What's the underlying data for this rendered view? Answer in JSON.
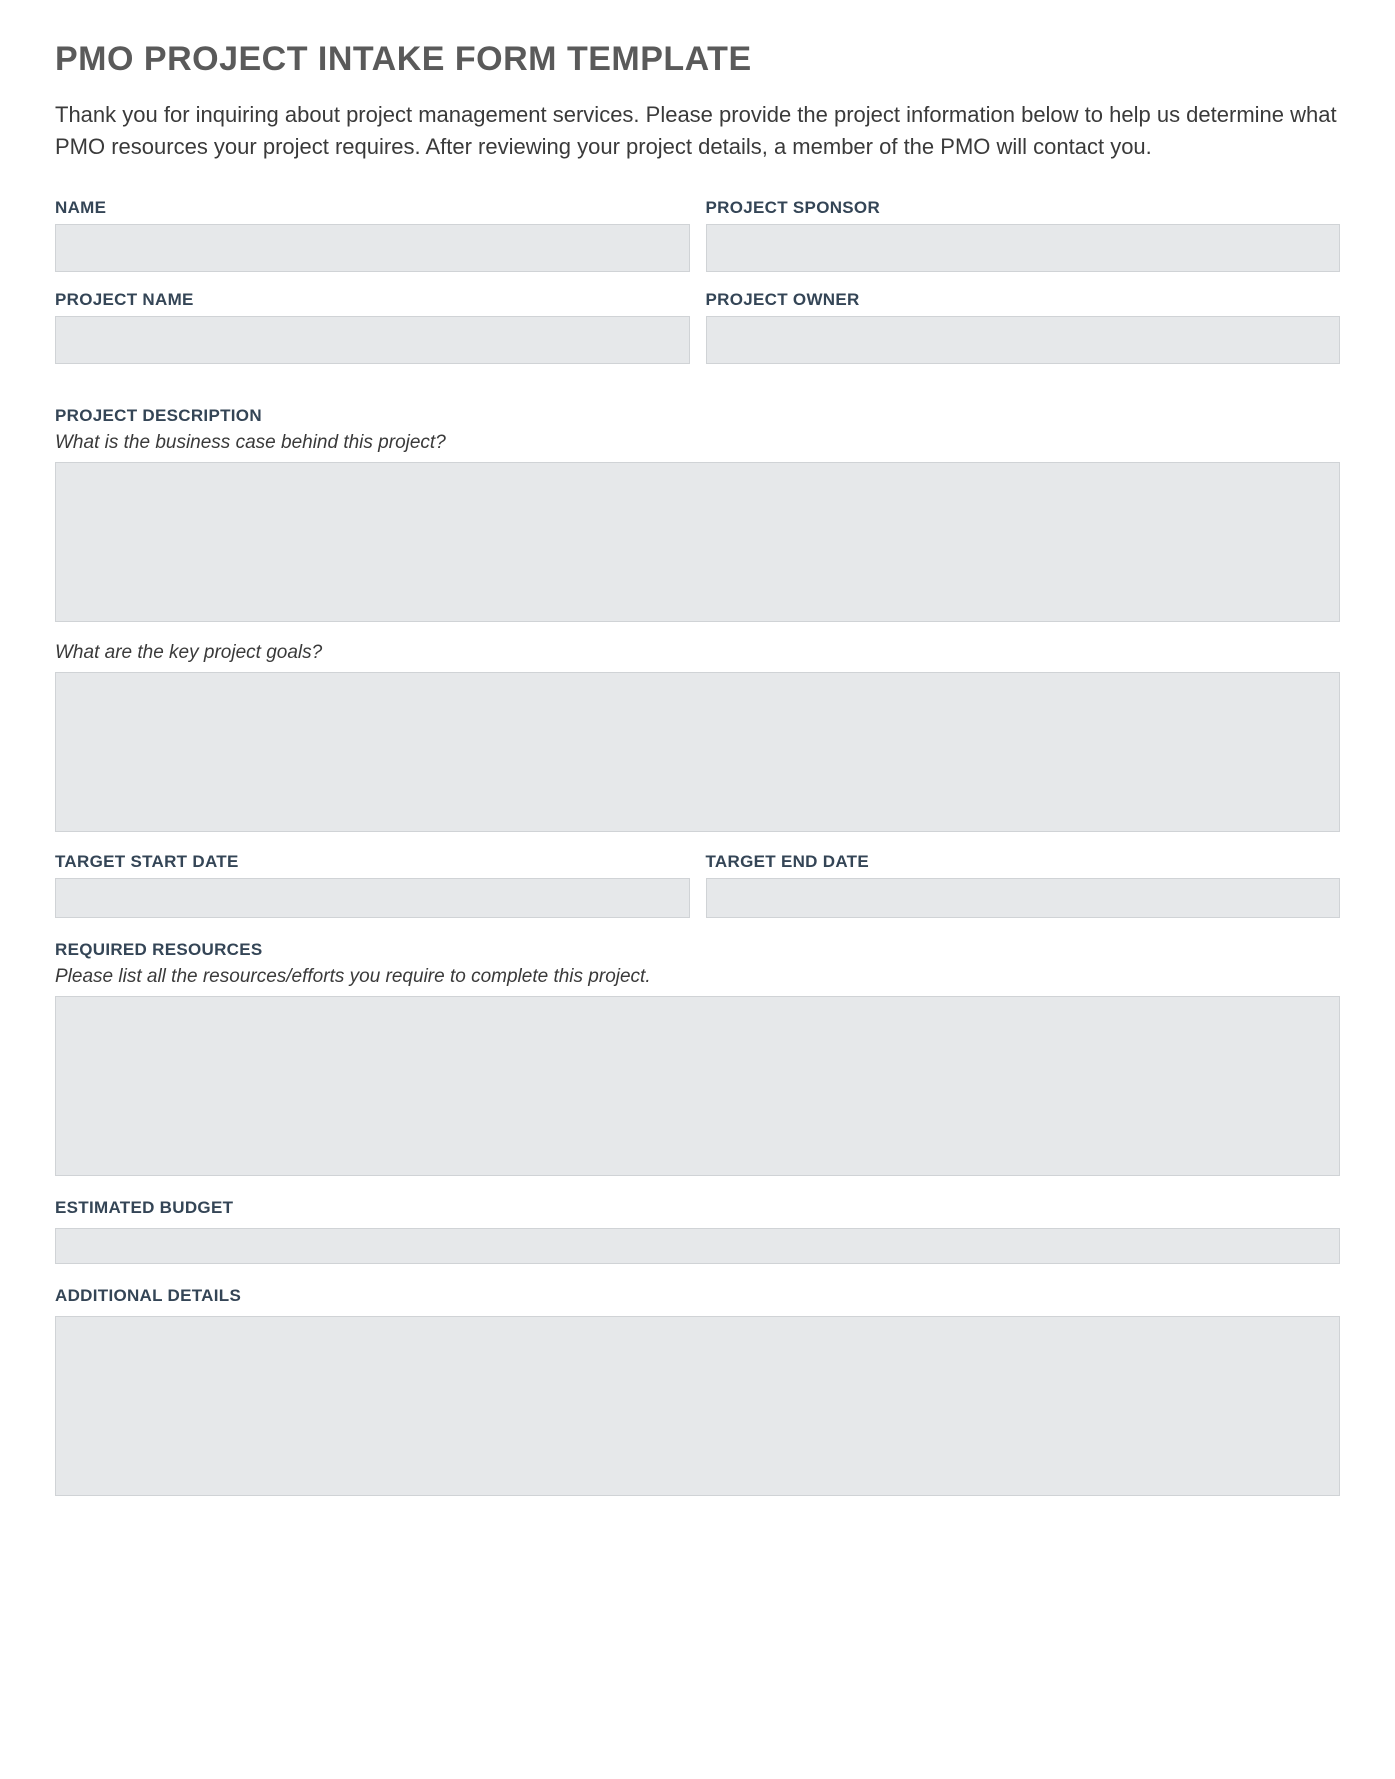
{
  "title": "PMO PROJECT INTAKE FORM TEMPLATE",
  "intro": "Thank you for inquiring about project management services. Please provide the project information below to help us determine what PMO resources your project requires. After reviewing your project details, a member of the PMO will contact you.",
  "fields": {
    "name_label": "NAME",
    "name_value": "",
    "project_sponsor_label": "PROJECT SPONSOR",
    "project_sponsor_value": "",
    "project_name_label": "PROJECT NAME",
    "project_name_value": "",
    "project_owner_label": "PROJECT OWNER",
    "project_owner_value": "",
    "project_description_label": "PROJECT DESCRIPTION",
    "business_case_prompt": "What is the business case behind this project?",
    "business_case_value": "",
    "key_goals_prompt": "What are the key project goals?",
    "key_goals_value": "",
    "target_start_label": "TARGET START DATE",
    "target_start_value": "",
    "target_end_label": "TARGET END DATE",
    "target_end_value": "",
    "required_resources_label": "REQUIRED RESOURCES",
    "required_resources_prompt": "Please list all the resources/efforts you require to complete this project.",
    "required_resources_value": "",
    "estimated_budget_label": "ESTIMATED BUDGET",
    "estimated_budget_value": "",
    "additional_details_label": "ADDITIONAL DETAILS",
    "additional_details_value": ""
  }
}
